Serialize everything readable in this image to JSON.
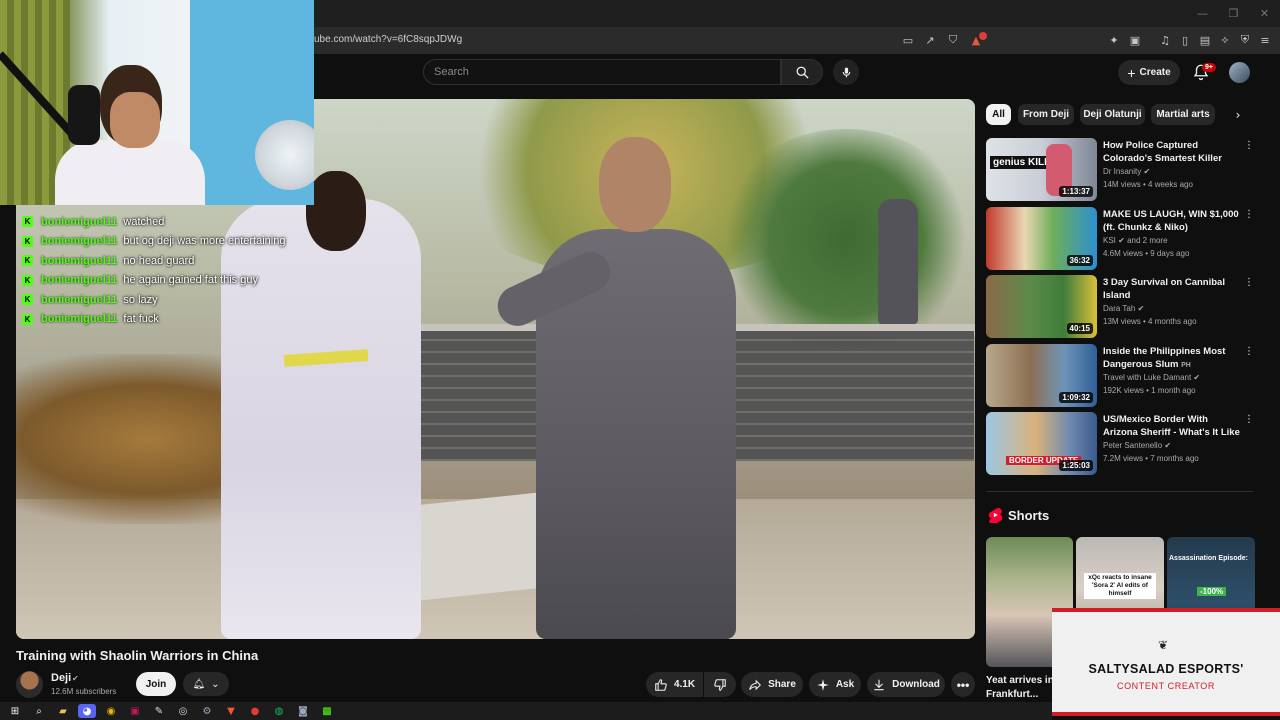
{
  "browser": {
    "url": "ube.com/watch?v=6fC8sqpJDWg",
    "brave_badge_color": "#e23b3b"
  },
  "masthead": {
    "search_placeholder": "Search",
    "create_label": "Create",
    "notifications_badge": "9+"
  },
  "chat": [
    {
      "user": "boniemiguel11",
      "message": "watched"
    },
    {
      "user": "boniemiguel11",
      "message": "but og deji was more entertaining"
    },
    {
      "user": "boniemiguel11",
      "message": "no head guard"
    },
    {
      "user": "boniemiguel11",
      "message": "he again gained fat this guy"
    },
    {
      "user": "boniemiguel11",
      "message": "so lazy"
    },
    {
      "user": "boniemiguel11",
      "message": "fat fuck"
    }
  ],
  "video": {
    "title": "Training with Shaolin Warriors in China",
    "channel": "Deji",
    "subscribers": "12.6M subscribers",
    "join_label": "Join",
    "likes": "4.1K",
    "share_label": "Share",
    "ask_label": "Ask",
    "download_label": "Download"
  },
  "chips": [
    {
      "label": "All",
      "active": true
    },
    {
      "label": "From Deji",
      "active": false
    },
    {
      "label": "Deji Olatunji",
      "active": false
    },
    {
      "label": "Martial arts",
      "active": false
    }
  ],
  "recommendations": [
    {
      "title": "How Police Captured Colorado's Smartest Killer",
      "channel": "Dr Insanity",
      "verified": true,
      "meta": "14M views • 4 weeks ago",
      "duration": "1:13:37",
      "thumb_text": "genius KILLER"
    },
    {
      "title": "MAKE US LAUGH, WIN $1,000 (ft. Chunkz & Niko)",
      "channel": "KSI",
      "verified": true,
      "extra": "and 2 more",
      "meta": "4.6M views • 9 days ago",
      "duration": "36:32",
      "thumb_text": ""
    },
    {
      "title": "3 Day Survival on Cannibal Island",
      "channel": "Dara Tah",
      "verified": true,
      "meta": "13M views • 4 months ago",
      "duration": "40:15",
      "thumb_text": ""
    },
    {
      "title": "Inside the Philippines Most Dangerous Slum",
      "title_suffix": "PH",
      "channel": "Travel with Luke Damant",
      "verified": true,
      "meta": "192K views • 1 month ago",
      "duration": "1:09:32",
      "thumb_text": ""
    },
    {
      "title": "US/Mexico Border With Arizona Sheriff - What's It Like Now? ...",
      "channel": "Peter Santenello",
      "verified": true,
      "meta": "7.2M views • 7 months ago",
      "duration": "1:25:03",
      "thumb_text": "BORDER UPDATE"
    }
  ],
  "shorts": {
    "heading": "Shorts",
    "items": [
      {
        "title": "Yeat arrives in Frankfurt..."
      },
      {
        "caption": "xQc reacts to insane 'Sora 2' AI edits of himself"
      },
      {
        "caption": "Assassination Episode:",
        "overlay": "-100%"
      }
    ]
  },
  "banner": {
    "name": "SALTYSALAD ESPORTS'",
    "role": "CONTENT CREATOR",
    "accent": "#d11c2a"
  },
  "colors": {
    "background": "#0f0f0f",
    "kick_green": "#53fc18",
    "yt_red": "#cc0000"
  }
}
